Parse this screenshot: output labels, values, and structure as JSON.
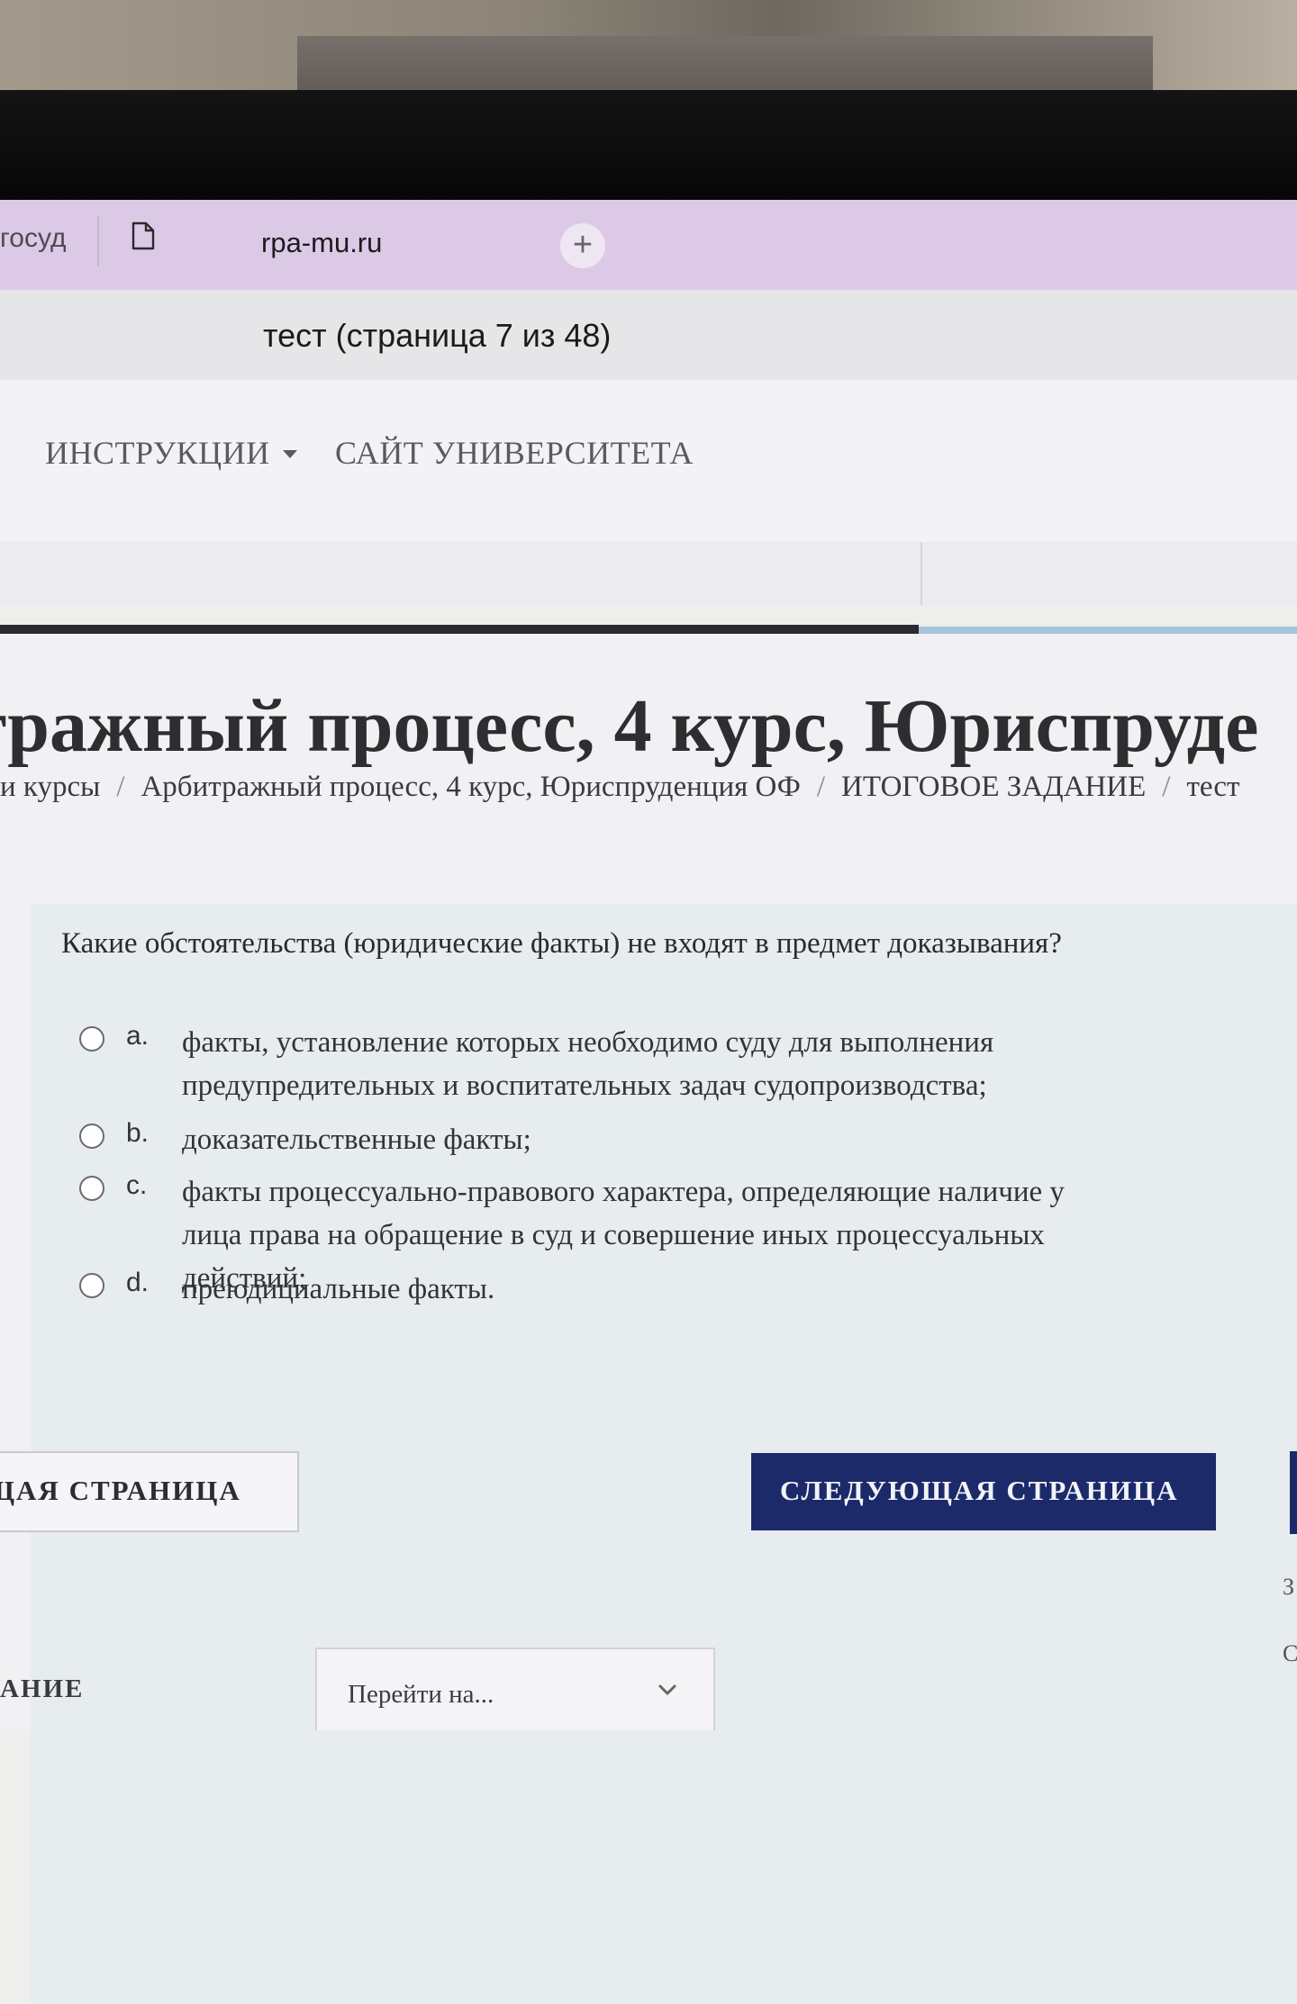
{
  "browser": {
    "prev_tab_label": "госуд",
    "tab_title": "rpa-mu.ru",
    "new_tab_label": "+",
    "page_title": "тест (страница 7 из 48)"
  },
  "nav": {
    "instructions": "ИНСТРУКЦИИ",
    "university_site": "САЙТ УНИВЕРСИТЕТА"
  },
  "course": {
    "title": "тражный процесс, 4 курс, Юриспруде"
  },
  "breadcrumb": {
    "items": [
      "и курсы",
      "Арбитражный процесс, 4 курс, Юриспруденция ОФ",
      "ИТОГОВОЕ ЗАДАНИЕ",
      "тест"
    ],
    "separator": "/"
  },
  "question": {
    "text": "Какие обстоятельства (юридические факты) не входят в предмет доказывания?",
    "answers": [
      {
        "letter": "a.",
        "text": "факты, установление которых необходимо суду для выполнения предупредительных и воспитательных задач судопроизводства;"
      },
      {
        "letter": "b.",
        "text": "доказательственные факты;"
      },
      {
        "letter": "c.",
        "text": "факты процессуально-правового характера, определяющие наличие у лица права на обращение в суд и совершение иных процессуальных действий;"
      },
      {
        "letter": "d.",
        "text": "преюдициальные факты."
      }
    ]
  },
  "buttons": {
    "previous": "ЩАЯ СТРАНИЦА",
    "next": "СЛЕДУЮЩАЯ СТРАНИЦА"
  },
  "footer": {
    "left_label": "АНИЕ",
    "jump_to": "Перейти на...",
    "edge_chars": [
      "З",
      "С"
    ]
  },
  "colors": {
    "tab_bar": "#dcc9e6",
    "next_button": "#1c2a6a",
    "progress_light": "#a8c3dc"
  }
}
